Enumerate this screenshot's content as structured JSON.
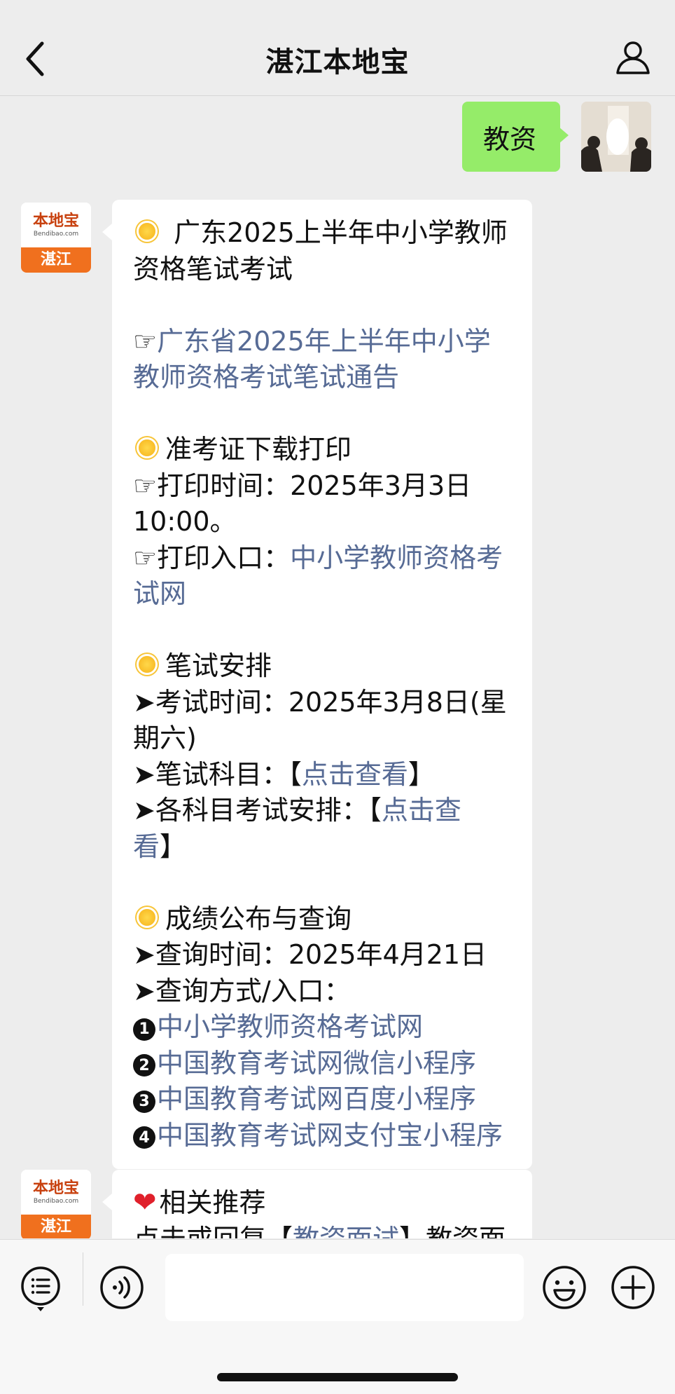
{
  "header": {
    "title": "湛江本地宝"
  },
  "outgoing": {
    "message": "教资"
  },
  "bot": {
    "avatar_text": "本地宝",
    "avatar_sub": "Bendibao.com",
    "avatar_city": "湛江"
  },
  "message1": {
    "title": "广东2025上半年中小学教师资格笔试考试",
    "notice_pointer": "☞",
    "notice_link": "广东省2025年上半年中小学教师资格考试笔试通告",
    "sec1_title": "准考证下载打印",
    "print_time_label": "☞打印时间：2025年3月3日10:00。",
    "print_entry_label": "☞打印入口：",
    "print_entry_link": "中小学教师资格考试网",
    "sec2_title": "笔试安排",
    "exam_time": "➤考试时间：2025年3月8日(星期六)",
    "subjects_label": "➤笔试科目：【",
    "subjects_link": "点击查看",
    "subjects_close": "】",
    "schedule_label": "➤各科目考试安排：【",
    "schedule_link": "点击查看",
    "schedule_close": "】",
    "sec3_title": "成绩公布与查询",
    "query_time": "➤查询时间：2025年4月21日",
    "query_method": "➤查询方式/入口：",
    "entries": [
      {
        "num": "1",
        "label": "中小学教师资格考试网"
      },
      {
        "num": "2",
        "label": "中国教育考试网微信小程序"
      },
      {
        "num": "3",
        "label": "中国教育考试网百度小程序"
      },
      {
        "num": "4",
        "label": "中国教育考试网支付宝小程序"
      }
    ]
  },
  "message2": {
    "title": "相关推荐",
    "line_prefix": "点击或回复【",
    "line_link": "教资面试",
    "line_suffix": "】教资面试"
  },
  "toolbar": {
    "input_placeholder": ""
  }
}
